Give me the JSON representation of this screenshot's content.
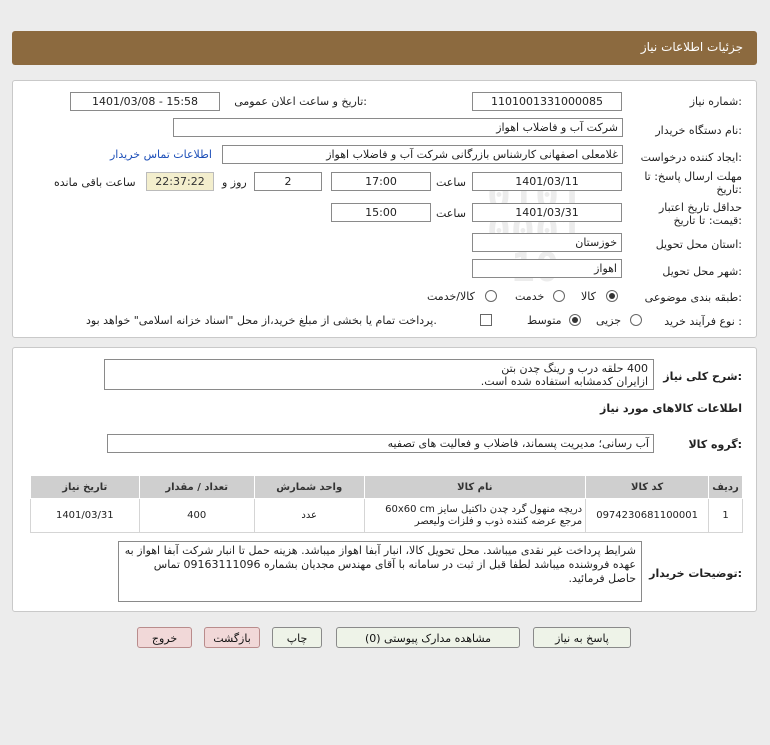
{
  "header": {
    "title": "جزئیات اطلاعات نیاز"
  },
  "form": {
    "need_number_label": "شماره نیاز:",
    "need_number": "1101001331000085",
    "announce_label": "تاریخ و ساعت اعلان عمومی:",
    "announce_value": "1401/03/08 - 15:58",
    "buyer_label": "نام دستگاه خریدار:",
    "buyer_value": "شرکت آب و فاضلاب اهواز",
    "creator_label": "ایجاد کننده درخواست:",
    "creator_value": "غلامعلی اصفهانی کارشناس بازرگانی شرکت آب و فاضلاب اهواز",
    "contact_link": "اطلاعات تماس خریدار",
    "deadline_label_1": "مهلت ارسال پاسخ: تا",
    "deadline_label_2": "تاریخ:",
    "deadline_date": "1401/03/11",
    "time_label": "ساعت",
    "deadline_time": "17:00",
    "days_value": "2",
    "days_label": "روز و",
    "remaining_time": "22:37:22",
    "remaining_label": "ساعت باقی مانده",
    "validity_label_1": "حداقل تاریخ اعتبار",
    "validity_label_2": "قیمت: تا تاریخ:",
    "validity_date": "1401/03/31",
    "validity_time": "15:00",
    "province_label": "استان محل تحویل:",
    "province_value": "خوزستان",
    "city_label": "شهر محل تحویل:",
    "city_value": "اهواز",
    "category_label": "طبقه بندی موضوعی:",
    "category_options": [
      "کالا",
      "خدمت",
      "کالا/خدمت"
    ],
    "process_label": "نوع فرآیند خرید :",
    "process_options": [
      "جزیی",
      "متوسط"
    ],
    "payment_note": "پرداخت تمام یا بخشی از مبلغ خرید،از محل \"اسناد خزانه اسلامی\" خواهد بود."
  },
  "description": {
    "label": "شرح کلی نیاز:",
    "line1": "400 حلقه درب و رینگ چدن بتن",
    "line2": "ازایران کدمشابه استفاده شده است."
  },
  "goods": {
    "section_title": "اطلاعات کالاهای مورد نیاز",
    "group_label": "گروه کالا:",
    "group_value": "آب رسانی؛ مدیریت پسماند، فاضلاب و فعالیت های تصفیه",
    "columns": [
      "ردیف",
      "کد کالا",
      "نام کالا",
      "واحد شمارش",
      "تعداد / مقدار",
      "تاریخ نیاز"
    ],
    "rows": [
      {
        "index": "1",
        "code": "0974230681100001",
        "name": "دریچه منهول گرد چدن داکتیل سایز 60x60 cm مرجع عرضه کننده ذوب و فلزات ولیعصر",
        "unit": "عدد",
        "qty": "400",
        "date": "1401/03/31"
      }
    ]
  },
  "buyer_notes": {
    "label": "توضیحات خریدار:",
    "text": "شرایط پرداخت غیر نقدی میباشد. محل تحویل کالا، انبار آبفا اهواز میباشد. هزینه حمل تا انبار شرکت آبفا اهواز به عهده فروشنده میباشد لطفا قبل از ثبت در سامانه با آقای مهندس مجدیان بشماره 09163111096 تماس حاصل فرمائید."
  },
  "buttons": {
    "reply": "پاسخ به نیاز",
    "attachments": "مشاهده مدارک پیوستی (0)",
    "print": "چاپ",
    "back": "بازگشت",
    "exit": "خروج"
  },
  "watermark": {
    "text": "ParsNamadData"
  },
  "colors": {
    "header": "#8c6a3f",
    "link": "#1d4fb8",
    "timer_bg": "#f3eecd"
  }
}
